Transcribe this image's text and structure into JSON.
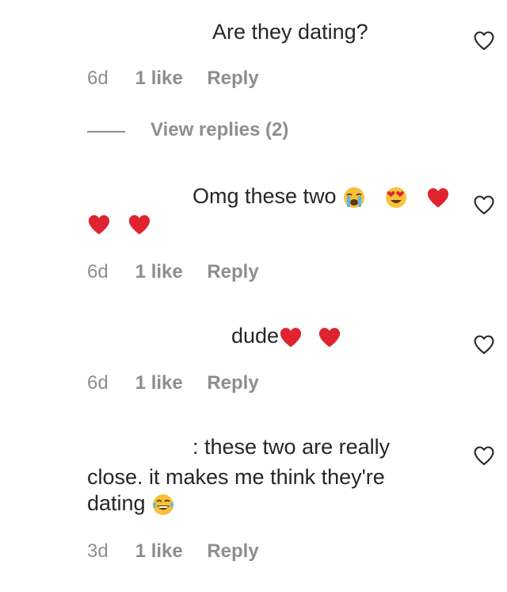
{
  "comments": [
    {
      "lines": [
        "Are they dating?"
      ],
      "age": "6d",
      "likes": "1 like",
      "reply": "Reply"
    },
    {
      "lines": [
        "Omg these two"
      ],
      "emojis_line1": [
        "loudly-crying-face",
        "smiling-face-with-heart-eyes",
        "red-heart"
      ],
      "emojis_line2": [
        "red-heart",
        "red-heart"
      ],
      "age": "6d",
      "likes": "1 like",
      "reply": "Reply"
    },
    {
      "lines": [
        "dude"
      ],
      "emojis_line1": [
        "red-heart",
        "red-heart"
      ],
      "age": "6d",
      "likes": "1 like",
      "reply": "Reply"
    },
    {
      "lines": [
        ": these two are really",
        "close. it makes me think they're",
        "dating"
      ],
      "emojis_line3": [
        "face-with-tears-of-joy"
      ],
      "age": "3d",
      "likes": "1 like",
      "reply": "Reply"
    }
  ],
  "view_replies": "View replies (2)",
  "colors": {
    "text": "#262626",
    "secondary": "#8e8e8e",
    "heart_emoji": "#e0242f",
    "face_emoji": "#f7c23a"
  },
  "icons": [
    "heart-outline-icon",
    "red-heart",
    "loudly-crying-face",
    "smiling-face-with-heart-eyes",
    "face-with-tears-of-joy"
  ]
}
